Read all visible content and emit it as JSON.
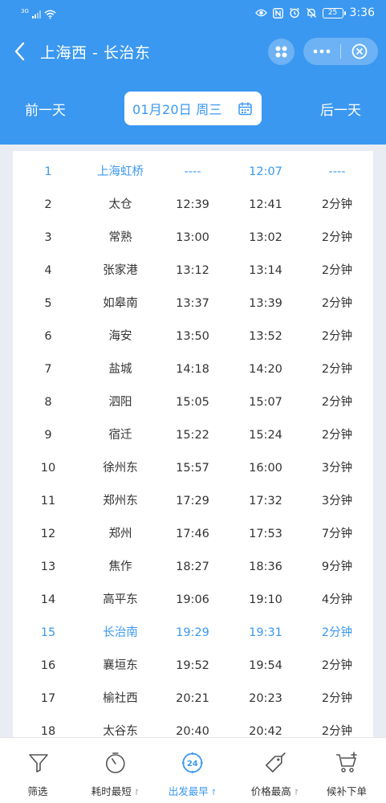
{
  "status_bar": {
    "network": "3G",
    "time": "3:36",
    "battery": "25"
  },
  "header": {
    "title": "上海西 - 长治东",
    "prev_day": "前一天",
    "date": "01月20日 周三",
    "next_day": "后一天"
  },
  "timetable": {
    "highlight_color": "#3b98f0",
    "rows": [
      {
        "no": "1",
        "station": "上海虹桥",
        "arrive": "----",
        "depart": "12:07",
        "stop": "----",
        "highlight": true
      },
      {
        "no": "2",
        "station": "太仓",
        "arrive": "12:39",
        "depart": "12:41",
        "stop": "2分钟",
        "highlight": false
      },
      {
        "no": "3",
        "station": "常熟",
        "arrive": "13:00",
        "depart": "13:02",
        "stop": "2分钟",
        "highlight": false
      },
      {
        "no": "4",
        "station": "张家港",
        "arrive": "13:12",
        "depart": "13:14",
        "stop": "2分钟",
        "highlight": false
      },
      {
        "no": "5",
        "station": "如皋南",
        "arrive": "13:37",
        "depart": "13:39",
        "stop": "2分钟",
        "highlight": false
      },
      {
        "no": "6",
        "station": "海安",
        "arrive": "13:50",
        "depart": "13:52",
        "stop": "2分钟",
        "highlight": false
      },
      {
        "no": "7",
        "station": "盐城",
        "arrive": "14:18",
        "depart": "14:20",
        "stop": "2分钟",
        "highlight": false
      },
      {
        "no": "8",
        "station": "泗阳",
        "arrive": "15:05",
        "depart": "15:07",
        "stop": "2分钟",
        "highlight": false
      },
      {
        "no": "9",
        "station": "宿迁",
        "arrive": "15:22",
        "depart": "15:24",
        "stop": "2分钟",
        "highlight": false
      },
      {
        "no": "10",
        "station": "徐州东",
        "arrive": "15:57",
        "depart": "16:00",
        "stop": "3分钟",
        "highlight": false
      },
      {
        "no": "11",
        "station": "郑州东",
        "arrive": "17:29",
        "depart": "17:32",
        "stop": "3分钟",
        "highlight": false
      },
      {
        "no": "12",
        "station": "郑州",
        "arrive": "17:46",
        "depart": "17:53",
        "stop": "7分钟",
        "highlight": false
      },
      {
        "no": "13",
        "station": "焦作",
        "arrive": "18:27",
        "depart": "18:36",
        "stop": "9分钟",
        "highlight": false
      },
      {
        "no": "14",
        "station": "高平东",
        "arrive": "19:06",
        "depart": "19:10",
        "stop": "4分钟",
        "highlight": false
      },
      {
        "no": "15",
        "station": "长治南",
        "arrive": "19:29",
        "depart": "19:31",
        "stop": "2分钟",
        "highlight": true
      },
      {
        "no": "16",
        "station": "襄垣东",
        "arrive": "19:52",
        "depart": "19:54",
        "stop": "2分钟",
        "highlight": false
      },
      {
        "no": "17",
        "station": "榆社西",
        "arrive": "20:21",
        "depart": "20:23",
        "stop": "2分钟",
        "highlight": false
      },
      {
        "no": "18",
        "station": "太谷东",
        "arrive": "20:40",
        "depart": "20:42",
        "stop": "2分钟",
        "highlight": false
      }
    ]
  },
  "tabbar": {
    "accent_color": "#3b98f0",
    "items": [
      {
        "id": "filter",
        "label": "筛选",
        "icon": "filter-icon",
        "sort_arrow": "",
        "active": false
      },
      {
        "id": "duration",
        "label": "耗时最短",
        "icon": "stopwatch-icon",
        "sort_arrow": "↾",
        "active": false
      },
      {
        "id": "departure",
        "label": "出发最早",
        "icon": "clock-24-icon",
        "icon_text": "24",
        "sort_arrow": "↾",
        "active": true
      },
      {
        "id": "price",
        "label": "价格最高",
        "icon": "price-tag-icon",
        "sort_arrow": "↾",
        "active": false
      },
      {
        "id": "waitlist",
        "label": "候补下单",
        "icon": "cart-add-icon",
        "sort_arrow": "",
        "active": false
      }
    ]
  }
}
